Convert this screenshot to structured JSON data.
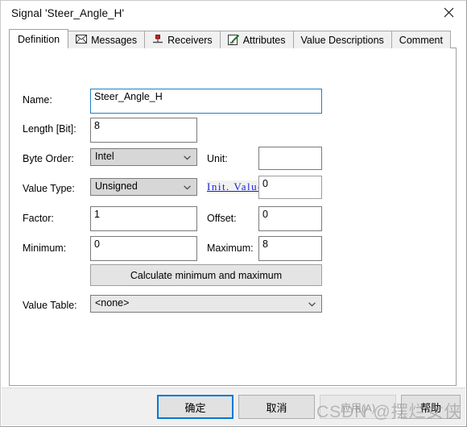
{
  "window": {
    "title": "Signal 'Steer_Angle_H'",
    "close_icon": "close-icon"
  },
  "tabs": [
    {
      "label": "Definition",
      "icon": "",
      "active": true
    },
    {
      "label": "Messages",
      "icon": "envelope-icon",
      "active": false
    },
    {
      "label": "Receivers",
      "icon": "node-pin-icon",
      "active": false
    },
    {
      "label": "Attributes",
      "icon": "notepad-pencil-icon",
      "active": false
    },
    {
      "label": "Value Descriptions",
      "icon": "",
      "active": false
    },
    {
      "label": "Comment",
      "icon": "",
      "active": false
    }
  ],
  "form": {
    "name_label": "Name:",
    "name_value": "Steer_Angle_H",
    "length_label": "Length [Bit]:",
    "length_value": "8",
    "byte_order_label": "Byte Order:",
    "byte_order_value": "Intel",
    "unit_label": "Unit:",
    "unit_value": "",
    "value_type_label": "Value Type:",
    "value_type_value": "Unsigned",
    "init_value_label": "Init. Value",
    "init_value_value": "0",
    "factor_label": "Factor:",
    "factor_value": "1",
    "offset_label": "Offset:",
    "offset_value": "0",
    "minimum_label": "Minimum:",
    "minimum_value": "0",
    "maximum_label": "Maximum:",
    "maximum_value": "8",
    "calculate_button_label": "Calculate minimum and maximum",
    "value_table_label": "Value Table:",
    "value_table_value": "<none>"
  },
  "footer": {
    "ok_label": "确定",
    "cancel_label": "取消",
    "apply_label": "应用(A)",
    "help_label": "帮助"
  },
  "watermark": {
    "text": "CSDN @摆烂女侠"
  },
  "colors": {
    "accent": "#0078d7",
    "focus_border": "#1d7fc4",
    "link": "#1122dd",
    "panel": "#f0f0f0"
  }
}
